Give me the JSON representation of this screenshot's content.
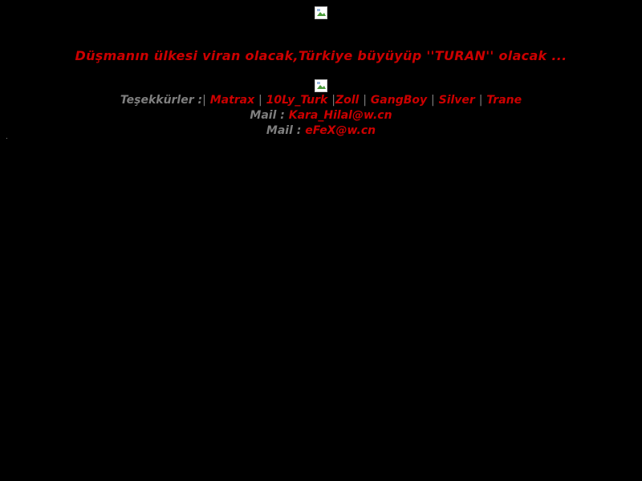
{
  "colors": {
    "background": "#000000",
    "accent_red": "#cc0000",
    "grey_text": "#7f7f7f"
  },
  "top_image": {
    "icon": "broken-image-icon"
  },
  "headline": "Düşmanın ülkesi viran olacak,Türkiye büyüyüp ''TURAN'' olacak ...",
  "mid_image": {
    "icon": "broken-image-icon"
  },
  "thanks": {
    "label": "Teşekkürler :",
    "separator": "|",
    "names": [
      "Matrax",
      "10Ly_Turk",
      "Zoll",
      "GangBoy",
      "Silver",
      "Trane"
    ]
  },
  "mails": [
    {
      "label": "Mail :",
      "address": "Kara_Hilal@w.cn"
    },
    {
      "label": "Mail :",
      "address": "eFeX@w.cn"
    }
  ]
}
